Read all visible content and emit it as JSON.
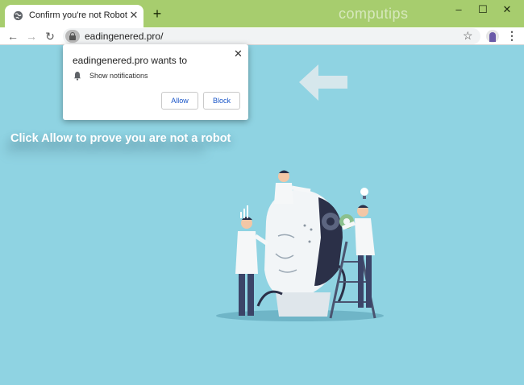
{
  "browser": {
    "tab_title": "Confirm you're not Robot",
    "tab_close": "✕",
    "new_tab": "+",
    "watermark": "computips",
    "window_controls": {
      "minimize": "–",
      "maximize": "☐",
      "close": "✕"
    },
    "nav": {
      "back": "←",
      "forward": "→",
      "reload": "↻"
    },
    "url": "eadingenered.pro/",
    "star": "☆",
    "menu": "⋮"
  },
  "popup": {
    "title": "eadingenered.pro wants to",
    "close": "✕",
    "permission": "Show notifications",
    "allow_label": "Allow",
    "block_label": "Block"
  },
  "page": {
    "cta_text": "Click Allow to prove you are not a robot"
  },
  "icons": [
    "globe-icon",
    "bell-icon",
    "lock-icon",
    "star-icon",
    "arrow-left-icon",
    "robot-illustration"
  ],
  "colors": {
    "titlebar": "#a7cd6e",
    "page_bg": "#8fd3e2",
    "button_text": "#1a56c8"
  }
}
